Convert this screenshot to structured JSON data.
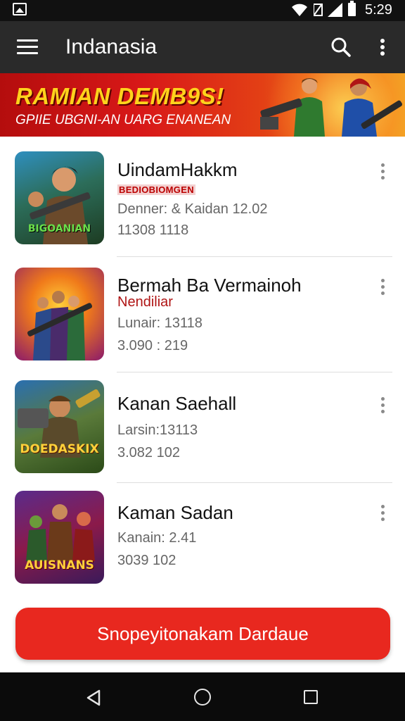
{
  "status_bar": {
    "time": "5:29",
    "icons": [
      "image-icon",
      "wifi-icon",
      "no-data-icon",
      "signal-icon",
      "battery-icon"
    ]
  },
  "app_bar": {
    "title": "Indanasia",
    "icons": [
      "menu-icon",
      "search-icon",
      "more-vert-icon"
    ]
  },
  "banner": {
    "headline": "RAMIAN DEMB9S!",
    "subheadline": "GPIIE UBGNI-AN UARG ENANEAN"
  },
  "games": [
    {
      "name": "UindamHakkm",
      "tag": "BEDIOBIOMGEN",
      "meta1": "Denner: & Kaidan 12.02",
      "meta2": "11308 1118",
      "thumb_label": "BIGOANIAN"
    },
    {
      "name": "Bermah Ba Vermainoh",
      "tag": "Nendiliar",
      "meta1": "Lunair: 13118",
      "meta2": "3.090 : 219",
      "thumb_label": ""
    },
    {
      "name": "Kanan Saehall",
      "tag": "",
      "meta1": "Larsin:13113",
      "meta2": "3.082 102",
      "thumb_label": "DOEDASKIX"
    },
    {
      "name": "Kaman Sadan",
      "tag": "",
      "meta1": "Kanain: 2.41",
      "meta2": "3039 102",
      "thumb_label": "AUISNANS"
    }
  ],
  "cta": {
    "label": "Snopeyitonakam Dardaue"
  },
  "nav_bar": {
    "icons": [
      "back-icon",
      "home-icon",
      "recents-icon"
    ]
  },
  "colors": {
    "app_bar": "#2a2a2a",
    "status_bar": "#111111",
    "accent_red": "#e8281f",
    "banner_yellow": "#ffd21c",
    "nav_bar": "#0b0b0b"
  }
}
